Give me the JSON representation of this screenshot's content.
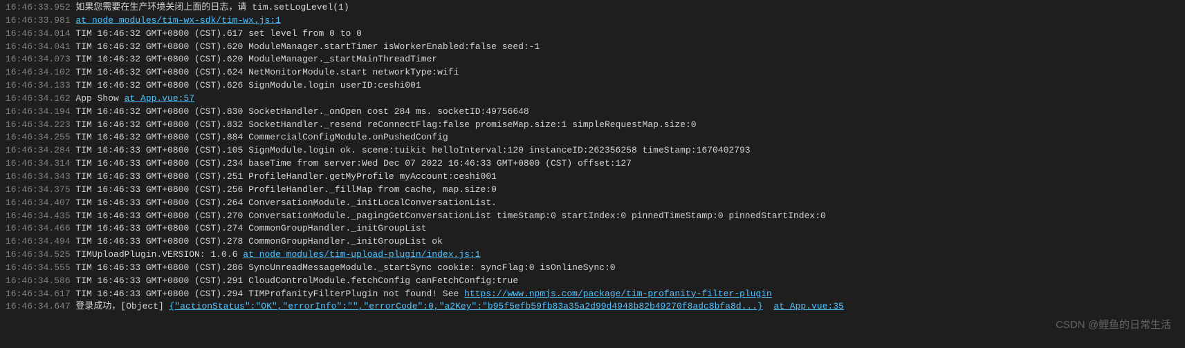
{
  "watermark": "CSDN @鲤鱼的日常生活",
  "lines": [
    {
      "ts": "16:46:33.952",
      "segments": [
        {
          "t": "msg",
          "v": " 如果您需要在生产环境关闭上面的日志，请 tim.setLogLevel(1)"
        }
      ]
    },
    {
      "ts": "16:46:33.981",
      "segments": [
        {
          "t": "msg",
          "v": " "
        },
        {
          "t": "link",
          "v": "at node_modules/tim-wx-sdk/tim-wx.js:1"
        }
      ]
    },
    {
      "ts": "16:46:34.014",
      "segments": [
        {
          "t": "msg",
          "v": " TIM 16:46:32 GMT+0800 (CST).617 set level from 0 to 0"
        }
      ]
    },
    {
      "ts": "16:46:34.041",
      "segments": [
        {
          "t": "msg",
          "v": " TIM 16:46:32 GMT+0800 (CST).620 ModuleManager.startTimer isWorkerEnabled:false seed:-1"
        }
      ]
    },
    {
      "ts": "16:46:34.073",
      "segments": [
        {
          "t": "msg",
          "v": " TIM 16:46:32 GMT+0800 (CST).620 ModuleManager._startMainThreadTimer"
        }
      ]
    },
    {
      "ts": "16:46:34.102",
      "segments": [
        {
          "t": "msg",
          "v": " TIM 16:46:32 GMT+0800 (CST).624 NetMonitorModule.start networkType:wifi"
        }
      ]
    },
    {
      "ts": "16:46:34.133",
      "segments": [
        {
          "t": "msg",
          "v": " TIM 16:46:32 GMT+0800 (CST).626 SignModule.login userID:ceshi001"
        }
      ]
    },
    {
      "ts": "16:46:34.162",
      "segments": [
        {
          "t": "msg",
          "v": " App Show "
        },
        {
          "t": "link",
          "v": "at App.vue:57"
        }
      ]
    },
    {
      "ts": "16:46:34.194",
      "segments": [
        {
          "t": "msg",
          "v": " TIM 16:46:32 GMT+0800 (CST).830 SocketHandler._onOpen cost 284 ms. socketID:49756648"
        }
      ]
    },
    {
      "ts": "16:46:34.223",
      "segments": [
        {
          "t": "msg",
          "v": " TIM 16:46:32 GMT+0800 (CST).832 SocketHandler._resend reConnectFlag:false promiseMap.size:1 simpleRequestMap.size:0"
        }
      ]
    },
    {
      "ts": "16:46:34.255",
      "segments": [
        {
          "t": "msg",
          "v": " TIM 16:46:32 GMT+0800 (CST).884 CommercialConfigModule.onPushedConfig"
        }
      ]
    },
    {
      "ts": "16:46:34.284",
      "segments": [
        {
          "t": "msg",
          "v": " TIM 16:46:33 GMT+0800 (CST).105 SignModule.login ok. scene:tuikit helloInterval:120 instanceID:262356258 timeStamp:1670402793"
        }
      ]
    },
    {
      "ts": "16:46:34.314",
      "segments": [
        {
          "t": "msg",
          "v": " TIM 16:46:33 GMT+0800 (CST).234 baseTime from server:Wed Dec 07 2022 16:46:33 GMT+0800 (CST) offset:127"
        }
      ]
    },
    {
      "ts": "16:46:34.343",
      "segments": [
        {
          "t": "msg",
          "v": " TIM 16:46:33 GMT+0800 (CST).251 ProfileHandler.getMyProfile myAccount:ceshi001"
        }
      ]
    },
    {
      "ts": "16:46:34.375",
      "segments": [
        {
          "t": "msg",
          "v": " TIM 16:46:33 GMT+0800 (CST).256 ProfileHandler._fillMap from cache, map.size:0"
        }
      ]
    },
    {
      "ts": "16:46:34.407",
      "segments": [
        {
          "t": "msg",
          "v": " TIM 16:46:33 GMT+0800 (CST).264 ConversationModule._initLocalConversationList."
        }
      ]
    },
    {
      "ts": "16:46:34.435",
      "segments": [
        {
          "t": "msg",
          "v": " TIM 16:46:33 GMT+0800 (CST).270 ConversationModule._pagingGetConversationList timeStamp:0 startIndex:0 pinnedTimeStamp:0 pinnedStartIndex:0"
        }
      ]
    },
    {
      "ts": "16:46:34.466",
      "segments": [
        {
          "t": "msg",
          "v": " TIM 16:46:33 GMT+0800 (CST).274 CommonGroupHandler._initGroupList"
        }
      ]
    },
    {
      "ts": "16:46:34.494",
      "segments": [
        {
          "t": "msg",
          "v": " TIM 16:46:33 GMT+0800 (CST).278 CommonGroupHandler._initGroupList ok"
        }
      ]
    },
    {
      "ts": "16:46:34.525",
      "segments": [
        {
          "t": "msg",
          "v": " TIMUploadPlugin.VERSION: 1.0.6 "
        },
        {
          "t": "link",
          "v": "at node_modules/tim-upload-plugin/index.js:1"
        }
      ]
    },
    {
      "ts": "16:46:34.555",
      "segments": [
        {
          "t": "msg",
          "v": " TIM 16:46:33 GMT+0800 (CST).286 SyncUnreadMessageModule._startSync cookie: syncFlag:0 isOnlineSync:0"
        }
      ]
    },
    {
      "ts": "16:46:34.586",
      "segments": [
        {
          "t": "msg",
          "v": " TIM 16:46:33 GMT+0800 (CST).291 CloudControlModule.fetchConfig canFetchConfig:true"
        }
      ]
    },
    {
      "ts": "16:46:34.617",
      "segments": [
        {
          "t": "msg",
          "v": " TIM 16:46:33 GMT+0800 (CST).294 TIMProfanityFilterPlugin not found! See "
        },
        {
          "t": "link",
          "v": "https://www.npmjs.com/package/tim-profanity-filter-plugin"
        }
      ]
    },
    {
      "ts": "16:46:34.647",
      "segments": [
        {
          "t": "msg",
          "v": " 登录成功，[Object] "
        },
        {
          "t": "link",
          "v": "{\"actionStatus\":\"OK\",\"errorInfo\":\"\",\"errorCode\":0,\"a2Key\":\"b95f5efb59fb83a35a2d99d4948b82b49270f8adc8bfa8d...}"
        },
        {
          "t": "msg",
          "v": "  "
        },
        {
          "t": "link",
          "v": "at App.vue:35"
        }
      ]
    }
  ]
}
